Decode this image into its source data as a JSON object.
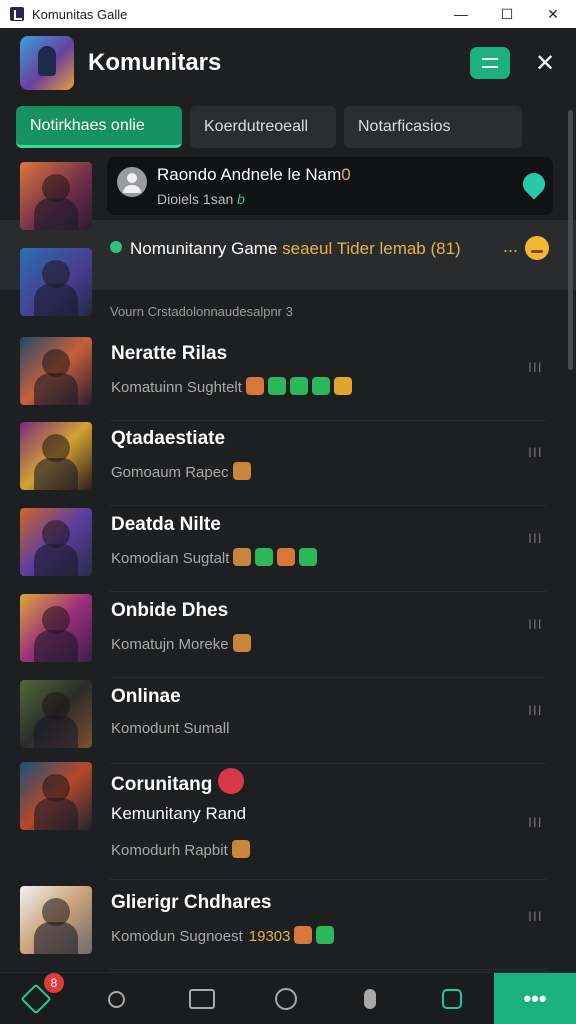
{
  "window": {
    "title": "Komunitas Galle",
    "minimize": "—",
    "maximize": "☐",
    "close": "✕"
  },
  "header": {
    "title": "Komunitars",
    "menu_icon": "menu-icon",
    "close_icon": "close-icon"
  },
  "tabs": [
    {
      "label": "Notirkhaes onlie",
      "active": true
    },
    {
      "label": "Koerdutreoeall",
      "active": false
    },
    {
      "label": "Notarficasios",
      "active": false
    }
  ],
  "notice": {
    "title": "Raondo Andnele le Nam",
    "title_accent": "0",
    "subtitle": "Dioiels 1san",
    "subtitle_accent": "b"
  },
  "highlight": {
    "text": "Nomunitanry Game",
    "accent": "seaeul Tider lemab (81)",
    "ellipsis": "...",
    "accent_color": "#e6b34a"
  },
  "section_label": "Vourn Crstadolonnaudesalpnr 3",
  "chats": [
    {
      "name": "Neratte Rilas",
      "message": "Komatuinn Sughtelt",
      "thumb_gradient": [
        "#1f4a6b",
        "#c8603a",
        "#2a1e2e"
      ],
      "stickers": [
        "#d9773b",
        "#2db75c",
        "#2db75c",
        "#2db75c",
        "#e0a62c"
      ]
    },
    {
      "name": "Qtadaestiate",
      "message": "Gomoaum Rapec",
      "thumb_gradient": [
        "#7a2c7a",
        "#d4a233",
        "#2b1a1a"
      ],
      "stickers": [
        "#c8863a"
      ]
    },
    {
      "name": "Deatda Nilte",
      "message": "Komodian Sugtalt",
      "thumb_gradient": [
        "#d2642a",
        "#5a3fa0",
        "#2a2a4a"
      ],
      "stickers": [
        "#c8863a",
        "#2db75c",
        "#d9773b",
        "#2db75c"
      ]
    },
    {
      "name": "Onbide Dhes",
      "message": "Komatujn Moreke",
      "thumb_gradient": [
        "#e0a63a",
        "#9b2f7a",
        "#3a1e4a"
      ],
      "stickers": [
        "#c8863a"
      ]
    },
    {
      "name": "Onlinae",
      "message": "Komodunt Sumall",
      "thumb_gradient": [
        "#4f6a3a",
        "#2b2b2b",
        "#7a5030"
      ],
      "stickers": []
    },
    {
      "name": "Corunitang",
      "message": "Komodurh Rapbit",
      "extra_line": "Kemunitany Rand",
      "thumb_gradient": [
        "#1d4f7a",
        "#b6492a",
        "#1e2430"
      ],
      "stickers": [
        "#c8863a"
      ]
    },
    {
      "name": "Glierigr Chdhares",
      "message": "Komodun Sugnoest",
      "message_accent": "19303",
      "thumb_gradient": [
        "#f2f2f2",
        "#c9a27a",
        "#6b6b6b"
      ],
      "stickers": [
        "#d9773b",
        "#2db75c"
      ]
    }
  ],
  "chat_more": "III",
  "bottom_nav": {
    "home_badge": "8",
    "more_label": "•••",
    "icons": [
      "home-icon",
      "search-icon",
      "feed-icon",
      "discover-icon",
      "voice-icon",
      "profile-icon"
    ]
  }
}
